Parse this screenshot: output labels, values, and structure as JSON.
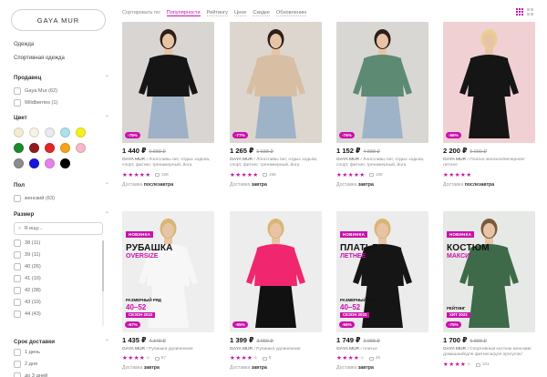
{
  "sidebar": {
    "brand_button": "GAYA MUR",
    "categories": [
      "Одежда",
      "Спортивная одежда"
    ],
    "seller": {
      "title": "Продавец",
      "options": [
        {
          "label": "Gaya Mur",
          "count": "(62)"
        },
        {
          "label": "Wildberries",
          "count": "(1)"
        }
      ]
    },
    "color": {
      "title": "Цвет",
      "swatches": [
        "#f3ecd2",
        "#f7f3e4",
        "#e9e9ee",
        "#aee0ee",
        "#f6ef1e",
        "#1e8a2e",
        "#8e1b1b",
        "#e02727",
        "#f7a21b",
        "#f7b9c8",
        "#8c8c8c",
        "#1515e0",
        "#e582ea",
        "#000000"
      ]
    },
    "gender": {
      "title": "Пол",
      "options": [
        {
          "label": "женский",
          "count": "(63)"
        }
      ]
    },
    "size": {
      "title": "Размер",
      "search_placeholder": "Я ищу...",
      "options": [
        {
          "label": "38",
          "count": "(11)"
        },
        {
          "label": "39",
          "count": "(11)"
        },
        {
          "label": "40",
          "count": "(26)"
        },
        {
          "label": "41",
          "count": "(10)"
        },
        {
          "label": "42",
          "count": "(38)"
        },
        {
          "label": "43",
          "count": "(10)"
        },
        {
          "label": "44",
          "count": "(43)"
        }
      ]
    },
    "delivery": {
      "title": "Срок доставки",
      "options": [
        {
          "label": "1 день"
        },
        {
          "label": "2 дня"
        },
        {
          "label": "до 3 дней"
        }
      ]
    }
  },
  "sort": {
    "label": "Сортировать по:",
    "options": [
      "Популярности",
      "Рейтингу",
      "Цене",
      "Скидке",
      "Обновлению"
    ],
    "active_index": 0
  },
  "products": [
    {
      "price": "1 440 ₽",
      "old_price": "5 888 ₽",
      "brand": "GAYA MUR",
      "desc": "Лонгсливы бег, отдых ходьба, спорт, фитнес тренажерный, йога",
      "stars": 5,
      "reviews": "198",
      "delivery_label": "Доставка",
      "delivery_when": "послезавтра",
      "discount": "-75%",
      "bg": "#d9d5d2",
      "top": "#151515",
      "bottom": "#9eb1c6",
      "skin": "#e8c4a6",
      "hair": "#2d1f17"
    },
    {
      "price": "1 265 ₽",
      "old_price": "5 588 ₽",
      "brand": "GAYA MUR",
      "desc": "Лонгсливы бег, отдых ходьба, спорт, фитнес тренажерный, йога",
      "stars": 5,
      "reviews": "198",
      "delivery_label": "Доставка",
      "delivery_when": "завтра",
      "discount": "-77%",
      "bg": "#dcd6cf",
      "top": "#d8bfa4",
      "bottom": "#9fb3c8",
      "skin": "#e8c4a6",
      "hair": "#2d1f17"
    },
    {
      "price": "1 152 ₽",
      "old_price": "4 888 ₽",
      "brand": "GAYA MUR",
      "desc": "Лонгсливы бег, отдых ходьба, спорт, фитнес тренажерный, йога",
      "stars": 5,
      "reviews": "198",
      "delivery_label": "Доставка",
      "delivery_when": "завтра",
      "discount": "-76%",
      "bg": "#d9d7d3",
      "top": "#5d8a72",
      "bottom": "#9fb3c8",
      "skin": "#e8c4a6",
      "hair": "#2d1f17"
    },
    {
      "price": "2 200 ₽",
      "old_price": "5 000 ₽",
      "brand": "GAYA MUR",
      "desc": "Платье женское/вечернее/летнее",
      "stars": 5,
      "reviews": "",
      "delivery_label": "Доставка",
      "delivery_when": "послезавтра",
      "discount": "-56%",
      "bg": "#f1d0d4",
      "top": "#151515",
      "bottom": "#151515",
      "skin": "#e8c4a6",
      "hair": "#e9d08e"
    },
    {
      "price": "1 435 ₽",
      "old_price": "4 348 ₽",
      "brand": "GAYA MUR",
      "desc": "Рубашка удлиненная",
      "stars": 4,
      "reviews": "67",
      "delivery_label": "Доставка",
      "delivery_when": "завтра",
      "discount": "-67%",
      "bg": "#eeeeee",
      "top": "#f7f7f7",
      "bottom": "#f7f7f7",
      "skin": "#e8c4a6",
      "hair": "#d8b673",
      "promo": {
        "tag": "НОВИНКА",
        "h1": "РУБАШКА",
        "h2": "OVERSIZE",
        "l1": "РАЗМЕРНЫЙ РЯД",
        "big": "40–52",
        "pill": "СЕЗОН 2022"
      }
    },
    {
      "price": "1 399 ₽",
      "old_price": "3 999 ₽",
      "brand": "GAYA MUR",
      "desc": "Рубашка удлиненная",
      "stars": 4,
      "reviews": "8",
      "delivery_label": "Доставка",
      "delivery_when": "завтра",
      "discount": "-65%",
      "bg": "#ededed",
      "top": "#f0266e",
      "bottom": "#111111",
      "skin": "#e8c4a6",
      "hair": "#d8b673"
    },
    {
      "price": "1 749 ₽",
      "old_price": "3 988 ₽",
      "brand": "GAYA MUR",
      "desc": "платье",
      "stars": 4,
      "reviews": "49",
      "delivery_label": "Доставка",
      "delivery_when": "завтра",
      "discount": "-56%",
      "bg": "#ececec",
      "top": "#151515",
      "bottom": "#151515",
      "skin": "#e8c4a6",
      "hair": "#d8b673",
      "promo": {
        "tag": "НОВИНКА",
        "h1": "ПЛАТЬЕ",
        "h2": "ЛЕТНЕЕ",
        "l1": "РАЗМЕРНЫЙ РЯД",
        "big": "40–52",
        "pill": "СЕЗОН 2022"
      }
    },
    {
      "price": "1 700 ₽",
      "old_price": "6 888 ₽",
      "brand": "GAYA MUR",
      "desc": "Спортивный костюм женский/домашний/для фитнеса/для прогулок/большие размеры",
      "stars": 4,
      "reviews": "161",
      "delivery_label": "",
      "delivery_when": "",
      "discount": "-75%",
      "bg": "#e7e9e6",
      "top": "#3e6a4a",
      "bottom": "#3e6a4a",
      "skin": "#e8c4a6",
      "hair": "#7a5a3a",
      "promo": {
        "tag": "НОВИНКА",
        "h1": "КОСТЮМ",
        "h2": "МАКСИ",
        "l1": "РЕЙТИНГ",
        "big": "",
        "pill": "ХИТ 2022"
      }
    }
  ]
}
